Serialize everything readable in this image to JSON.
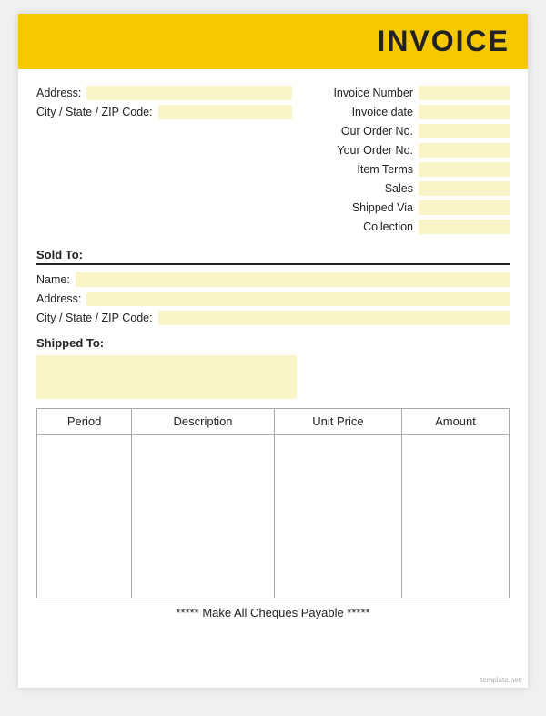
{
  "header": {
    "title": "INVOICE",
    "background": "#f5c800"
  },
  "left_top": {
    "address_label": "Address:",
    "city_label": "City / State / ZIP Code:"
  },
  "right_top": {
    "fields": [
      {
        "label": "Invoice Number",
        "value": ""
      },
      {
        "label": "Invoice date",
        "value": ""
      },
      {
        "label": "Our Order No.",
        "value": ""
      },
      {
        "label": "Your Order No.",
        "value": ""
      },
      {
        "label": "Item Terms",
        "value": ""
      },
      {
        "label": "Sales",
        "value": ""
      },
      {
        "label": "Shipped Via",
        "value": ""
      },
      {
        "label": "Collection",
        "value": ""
      }
    ]
  },
  "sold_to": {
    "label": "Sold To:",
    "name_label": "Name:",
    "address_label": "Address:",
    "city_label": "City / State / ZIP Code:"
  },
  "shipped_to": {
    "label": "Shipped To:"
  },
  "table": {
    "columns": [
      "Period",
      "Description",
      "Unit Price",
      "Amount"
    ]
  },
  "footer": {
    "text": "***** Make All Cheques Payable *****"
  },
  "watermark": "template.net"
}
